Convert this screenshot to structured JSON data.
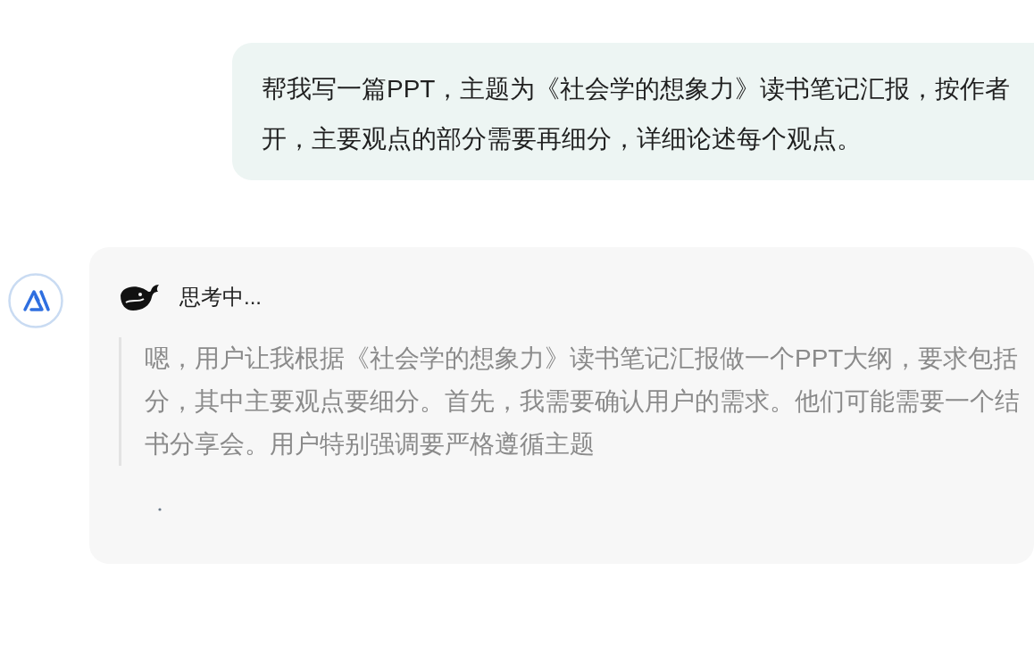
{
  "user_message": {
    "lines": [
      "帮我写一篇PPT，主题为《社会学的想象力》读书笔记汇报，按作者",
      "开，主要观点的部分需要再细分，详细论述每个观点。"
    ]
  },
  "assistant": {
    "status": "思考中...",
    "thinking_lines": [
      "嗯，用户让我根据《社会学的想象力》读书笔记汇报做一个PPT大纲，要求包括",
      "分，其中主要观点要细分。首先，我需要确认用户的需求。他们可能需要一个结",
      "书分享会。用户特别强调要严格遵循主题"
    ]
  }
}
